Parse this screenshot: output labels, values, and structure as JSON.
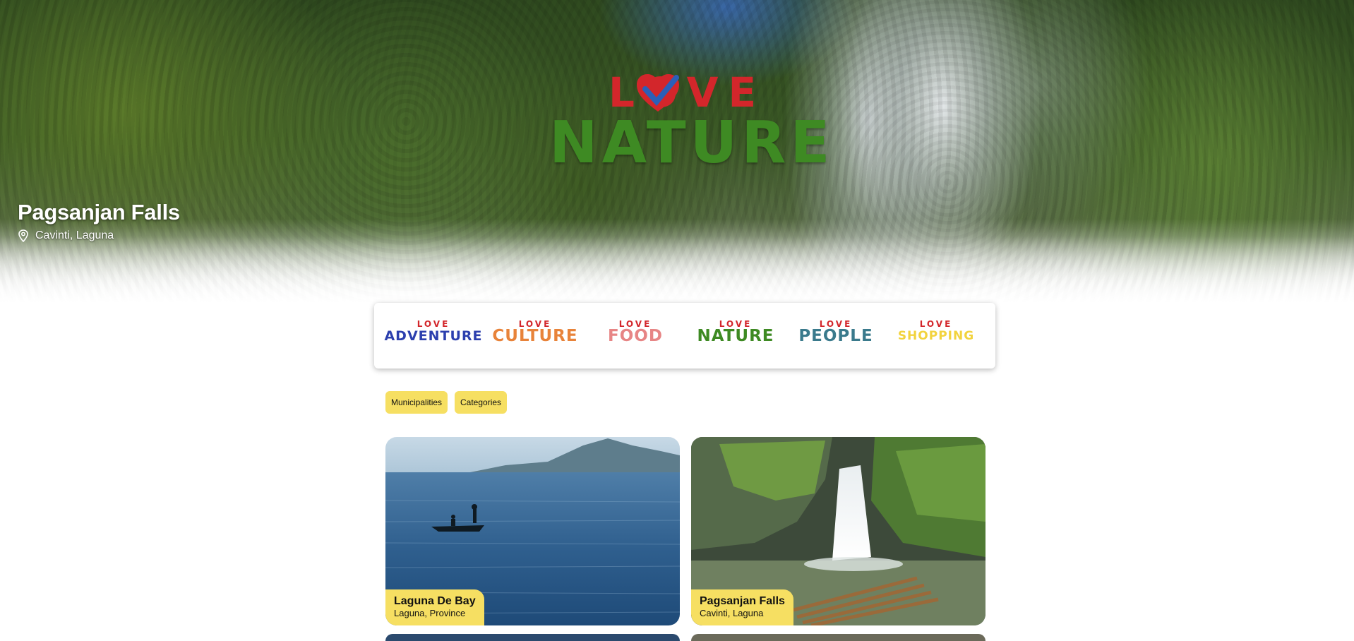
{
  "hero": {
    "logo_top": "LOVE",
    "logo_bottom": "NATURE",
    "title": "Pagsanjan Falls",
    "location": "Cavinti, Laguna"
  },
  "categories": [
    {
      "love": "LOVE",
      "word": "ADVENTURE",
      "color": "#2c3fae"
    },
    {
      "love": "LOVE",
      "word": "CULTURE",
      "color": "#e8833a"
    },
    {
      "love": "LOVE",
      "word": "FOOD",
      "color": "#e78585"
    },
    {
      "love": "LOVE",
      "word": "NATURE",
      "color": "#3e8a23"
    },
    {
      "love": "LOVE",
      "word": "PEOPLE",
      "color": "#3a7a8c"
    },
    {
      "love": "LOVE",
      "word": "SHOPPING",
      "color": "#f2d33e"
    }
  ],
  "filters": {
    "municipalities": "Municipalities",
    "categories": "Categories"
  },
  "cards": [
    {
      "title": "Laguna De Bay",
      "subtitle": "Laguna, Province"
    },
    {
      "title": "Pagsanjan Falls",
      "subtitle": "Cavinti, Laguna"
    }
  ],
  "colors": {
    "accent_yellow": "#f6df62",
    "love_red": "#d3262b",
    "nature_green": "#3e8a23"
  },
  "icons": {
    "location": "map-pin-icon",
    "heart": "heart-check-icon"
  }
}
